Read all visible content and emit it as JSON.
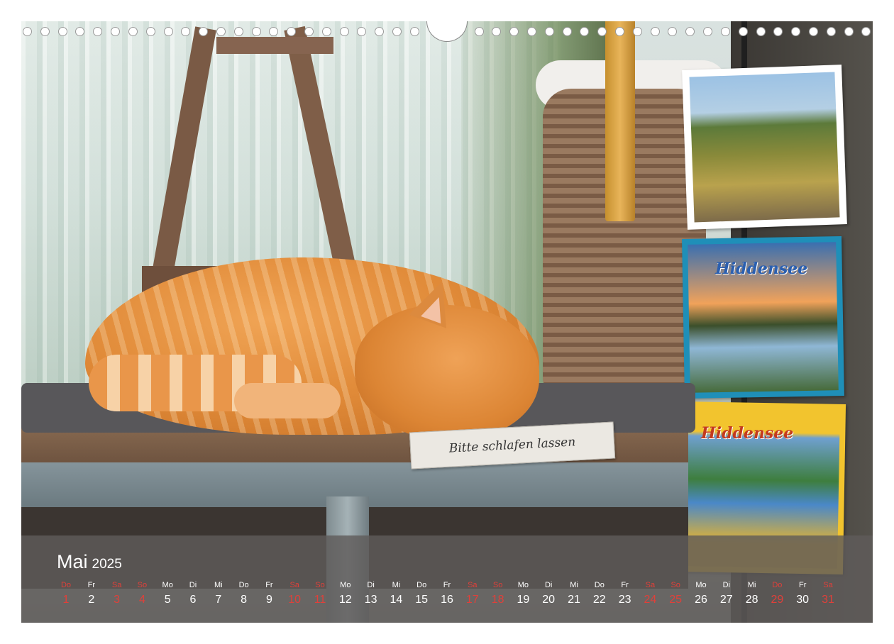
{
  "calendar": {
    "month": "Mai",
    "year": "2025",
    "weekend_color": "#e0403a",
    "days": [
      {
        "wd": "Do",
        "n": "1",
        "red": true
      },
      {
        "wd": "Fr",
        "n": "2",
        "red": false
      },
      {
        "wd": "Sa",
        "n": "3",
        "red": true
      },
      {
        "wd": "So",
        "n": "4",
        "red": true
      },
      {
        "wd": "Mo",
        "n": "5",
        "red": false
      },
      {
        "wd": "Di",
        "n": "6",
        "red": false
      },
      {
        "wd": "Mi",
        "n": "7",
        "red": false
      },
      {
        "wd": "Do",
        "n": "8",
        "red": false
      },
      {
        "wd": "Fr",
        "n": "9",
        "red": false
      },
      {
        "wd": "Sa",
        "n": "10",
        "red": true
      },
      {
        "wd": "So",
        "n": "11",
        "red": true
      },
      {
        "wd": "Mo",
        "n": "12",
        "red": false
      },
      {
        "wd": "Di",
        "n": "13",
        "red": false
      },
      {
        "wd": "Mi",
        "n": "14",
        "red": false
      },
      {
        "wd": "Do",
        "n": "15",
        "red": false
      },
      {
        "wd": "Fr",
        "n": "16",
        "red": false
      },
      {
        "wd": "Sa",
        "n": "17",
        "red": true
      },
      {
        "wd": "So",
        "n": "18",
        "red": true
      },
      {
        "wd": "Mo",
        "n": "19",
        "red": false
      },
      {
        "wd": "Di",
        "n": "20",
        "red": false
      },
      {
        "wd": "Mi",
        "n": "21",
        "red": false
      },
      {
        "wd": "Do",
        "n": "22",
        "red": false
      },
      {
        "wd": "Fr",
        "n": "23",
        "red": false
      },
      {
        "wd": "Sa",
        "n": "24",
        "red": true
      },
      {
        "wd": "So",
        "n": "25",
        "red": true
      },
      {
        "wd": "Mo",
        "n": "26",
        "red": false
      },
      {
        "wd": "Di",
        "n": "27",
        "red": false
      },
      {
        "wd": "Mi",
        "n": "28",
        "red": false
      },
      {
        "wd": "Do",
        "n": "29",
        "red": true
      },
      {
        "wd": "Fr",
        "n": "30",
        "red": false
      },
      {
        "wd": "Sa",
        "n": "31",
        "red": true
      }
    ]
  },
  "photo": {
    "sign_text": "Bitte schlafen lassen",
    "postcard_label_1": "Hiddensee",
    "postcard_label_2": "Hiddensee"
  }
}
